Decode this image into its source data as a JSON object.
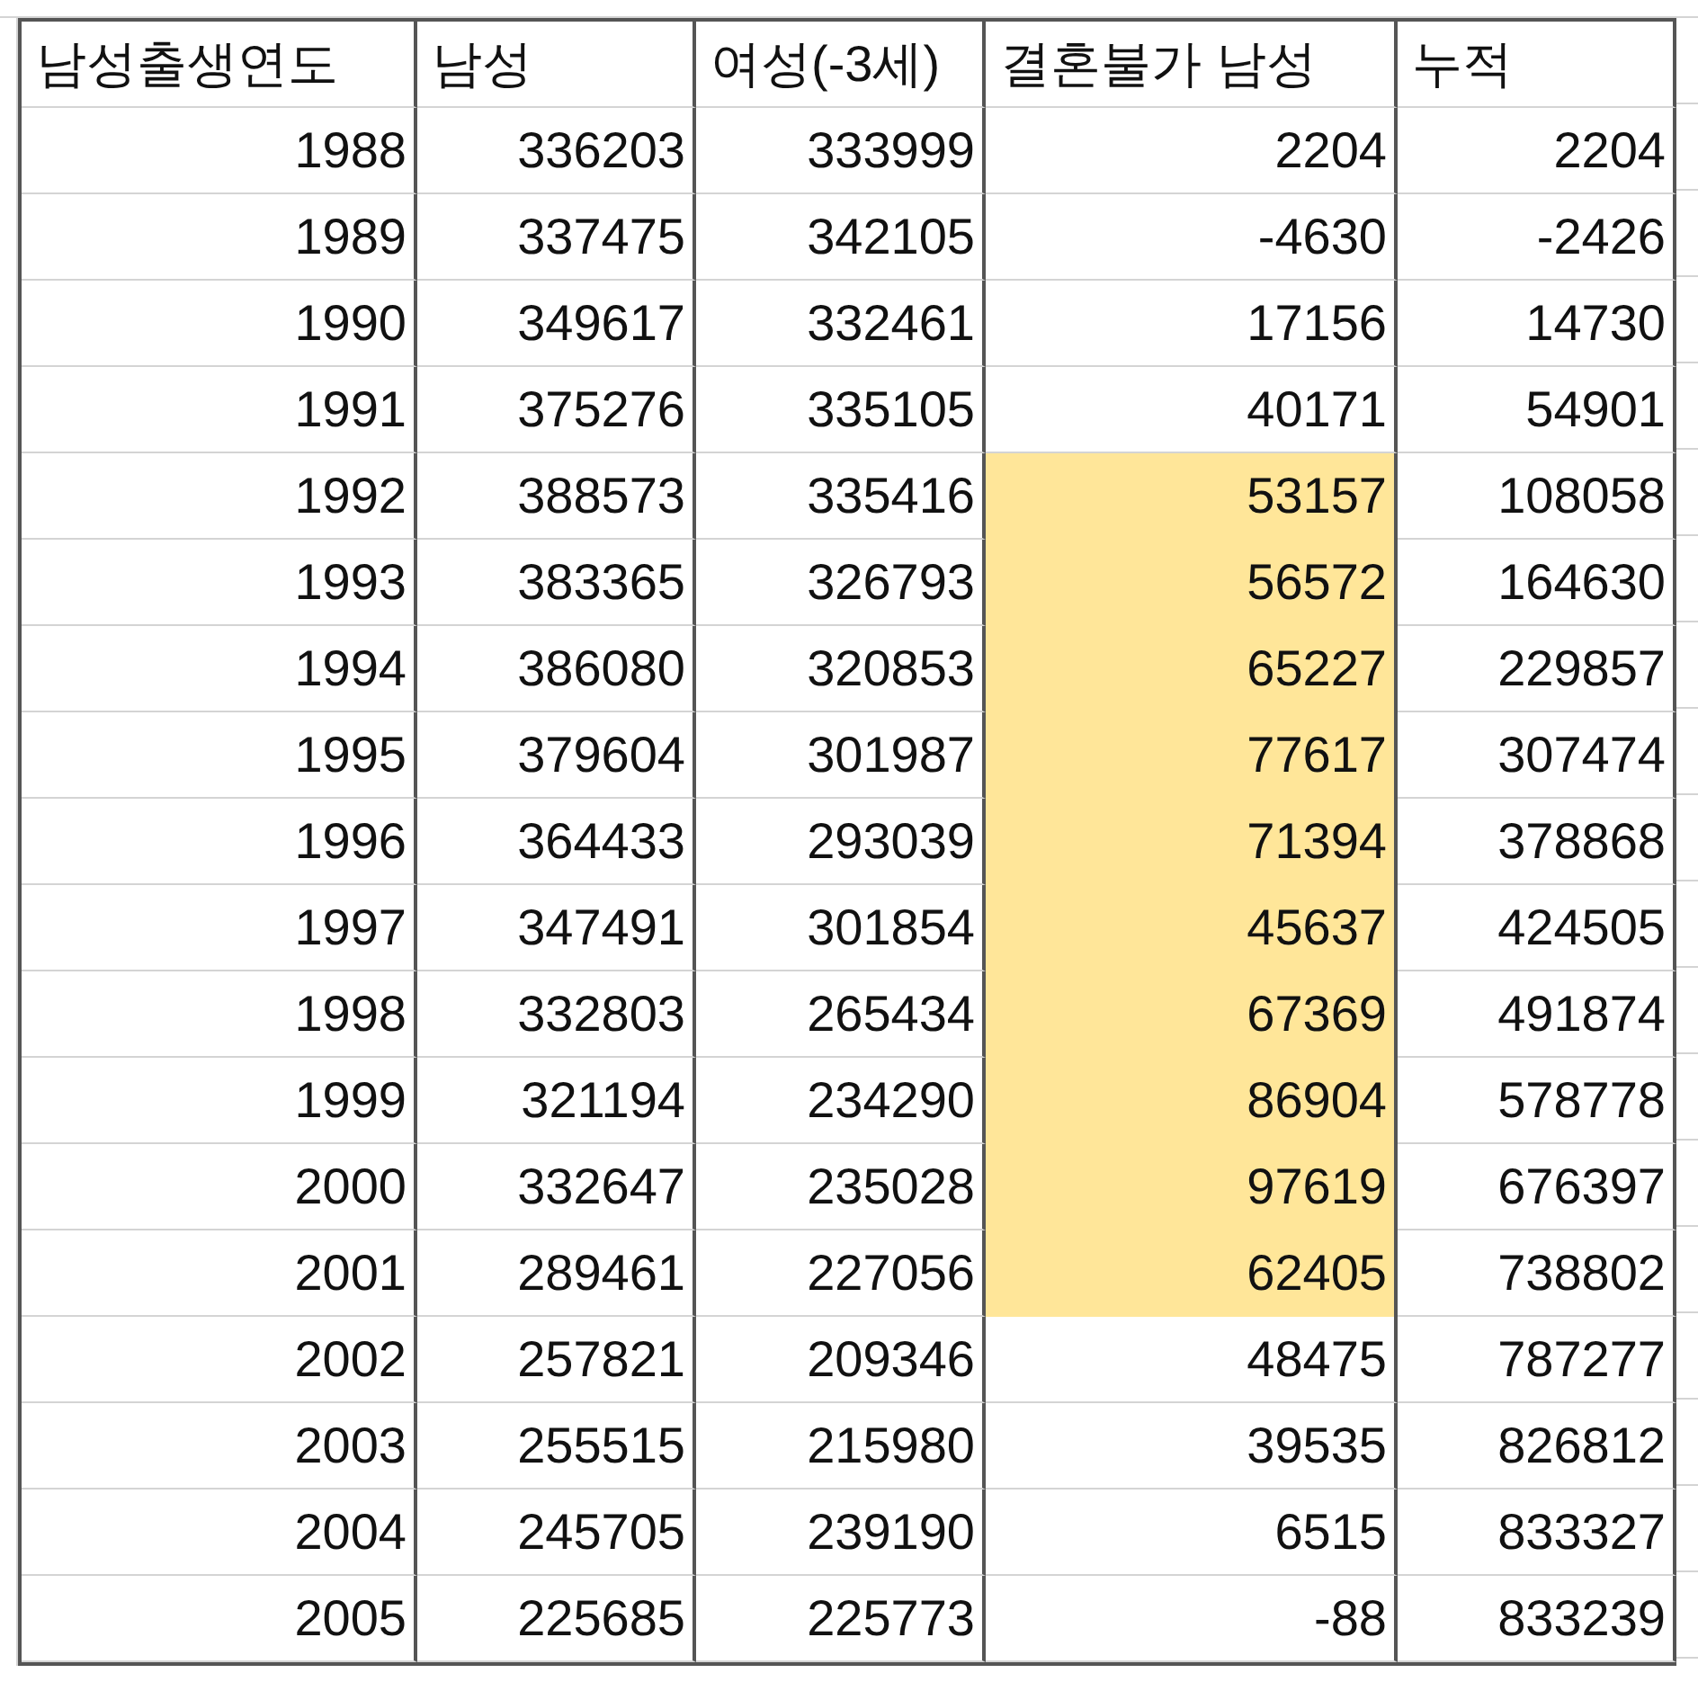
{
  "table": {
    "columns": [
      "남성출생연도",
      "남성",
      "여성(-3세)",
      "결혼불가 남성",
      "누적"
    ],
    "rows": [
      {
        "cells": [
          "1988",
          "336203",
          "333999",
          "2204",
          "2204"
        ],
        "highlighted": false
      },
      {
        "cells": [
          "1989",
          "337475",
          "342105",
          "-4630",
          "-2426"
        ],
        "highlighted": false
      },
      {
        "cells": [
          "1990",
          "349617",
          "332461",
          "17156",
          "14730"
        ],
        "highlighted": false
      },
      {
        "cells": [
          "1991",
          "375276",
          "335105",
          "40171",
          "54901"
        ],
        "highlighted": false
      },
      {
        "cells": [
          "1992",
          "388573",
          "335416",
          "53157",
          "108058"
        ],
        "highlighted": true
      },
      {
        "cells": [
          "1993",
          "383365",
          "326793",
          "56572",
          "164630"
        ],
        "highlighted": true
      },
      {
        "cells": [
          "1994",
          "386080",
          "320853",
          "65227",
          "229857"
        ],
        "highlighted": true
      },
      {
        "cells": [
          "1995",
          "379604",
          "301987",
          "77617",
          "307474"
        ],
        "highlighted": true
      },
      {
        "cells": [
          "1996",
          "364433",
          "293039",
          "71394",
          "378868"
        ],
        "highlighted": true
      },
      {
        "cells": [
          "1997",
          "347491",
          "301854",
          "45637",
          "424505"
        ],
        "highlighted": true
      },
      {
        "cells": [
          "1998",
          "332803",
          "265434",
          "67369",
          "491874"
        ],
        "highlighted": true
      },
      {
        "cells": [
          "1999",
          "321194",
          "234290",
          "86904",
          "578778"
        ],
        "highlighted": true
      },
      {
        "cells": [
          "2000",
          "332647",
          "235028",
          "97619",
          "676397"
        ],
        "highlighted": true
      },
      {
        "cells": [
          "2001",
          "289461",
          "227056",
          "62405",
          "738802"
        ],
        "highlighted": true
      },
      {
        "cells": [
          "2002",
          "257821",
          "209346",
          "48475",
          "787277"
        ],
        "highlighted": false
      },
      {
        "cells": [
          "2003",
          "255515",
          "215980",
          "39535",
          "826812"
        ],
        "highlighted": false
      },
      {
        "cells": [
          "2004",
          "245705",
          "239190",
          "6515",
          "833327"
        ],
        "highlighted": false
      },
      {
        "cells": [
          "2005",
          "225685",
          "225773",
          "-88",
          "833239"
        ],
        "highlighted": false
      }
    ]
  }
}
